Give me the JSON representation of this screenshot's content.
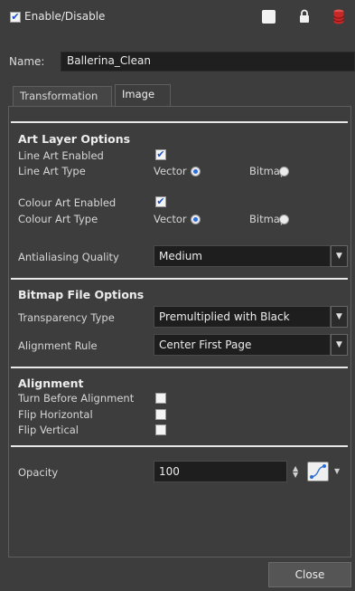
{
  "header": {
    "enable_label": "Enable/Disable",
    "enabled": true
  },
  "name_row": {
    "label": "Name:",
    "value": "Ballerina_Clean"
  },
  "tabs": [
    {
      "label": "Transformation",
      "active": false
    },
    {
      "label": "Image",
      "active": true
    }
  ],
  "art_layer": {
    "title": "Art Layer Options",
    "line_art_enabled_label": "Line Art Enabled",
    "line_art_enabled": true,
    "line_art_type_label": "Line Art Type",
    "line_art_type": "Vector",
    "colour_art_enabled_label": "Colour Art Enabled",
    "colour_art_enabled": true,
    "colour_art_type_label": "Colour Art Type",
    "colour_art_type": "Vector",
    "vector_label": "Vector",
    "bitmap_label": "Bitmap",
    "antialiasing_label": "Antialiasing Quality",
    "antialiasing_value": "Medium"
  },
  "bitmap_file": {
    "title": "Bitmap File Options",
    "transparency_label": "Transparency Type",
    "transparency_value": "Premultiplied with Black",
    "alignment_rule_label": "Alignment Rule",
    "alignment_rule_value": "Center First Page"
  },
  "alignment": {
    "title": "Alignment",
    "turn_before_label": "Turn Before Alignment",
    "turn_before": false,
    "flip_h_label": "Flip Horizontal",
    "flip_h": false,
    "flip_v_label": "Flip Vertical",
    "flip_v": false
  },
  "opacity": {
    "label": "Opacity",
    "value": "100"
  },
  "footer": {
    "close_label": "Close"
  },
  "icons": [
    "checkbox-checked-icon",
    "color-swatch-icon",
    "lock-icon",
    "database-icon",
    "radio-on-icon",
    "radio-off-icon",
    "dropdown-arrow-icon",
    "spinner-icon",
    "function-curve-icon"
  ],
  "colors": {
    "background": "#3d3d3d",
    "field": "#1e1e1e",
    "accent": "#2a6cd8",
    "db_icon": "#c62828"
  }
}
